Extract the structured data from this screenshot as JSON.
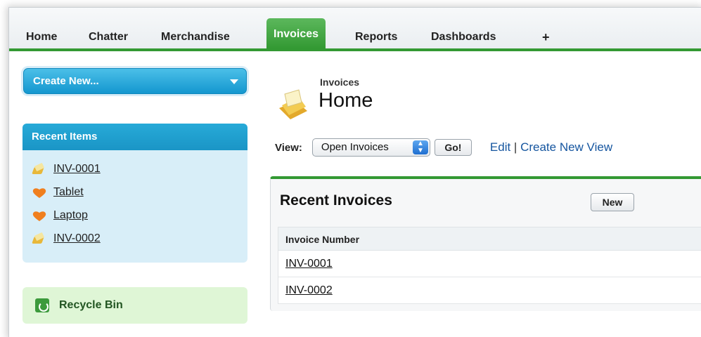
{
  "tabs": [
    {
      "label": "Home",
      "active": false
    },
    {
      "label": "Chatter",
      "active": false
    },
    {
      "label": "Merchandise",
      "active": false
    },
    {
      "label": "Invoices",
      "active": true
    },
    {
      "label": "Reports",
      "active": false
    },
    {
      "label": "Dashboards",
      "active": false
    },
    {
      "label": "+",
      "active": false
    }
  ],
  "sidebar": {
    "create_new_label": "Create New...",
    "recent_items_title": "Recent Items",
    "recent_items": [
      {
        "label": "INV-0001",
        "icon": "invoice-icon"
      },
      {
        "label": "Tablet",
        "icon": "heart-icon"
      },
      {
        "label": "Laptop",
        "icon": "heart-icon"
      },
      {
        "label": "INV-0002",
        "icon": "invoice-icon"
      }
    ],
    "recycle_bin_label": "Recycle Bin"
  },
  "page": {
    "object_label": "Invoices",
    "title": "Home"
  },
  "view": {
    "label": "View:",
    "selected": "Open Invoices",
    "go_label": "Go!",
    "edit_label": "Edit",
    "separator": " | ",
    "create_view_label": "Create New View"
  },
  "recent_panel": {
    "title": "Recent Invoices",
    "new_label": "New",
    "column_header": "Invoice Number",
    "rows": [
      "INV-0001",
      "INV-0002"
    ]
  },
  "colors": {
    "accent_green": "#339933",
    "sidebar_blue": "#1a95c6",
    "link_blue": "#15559f"
  }
}
